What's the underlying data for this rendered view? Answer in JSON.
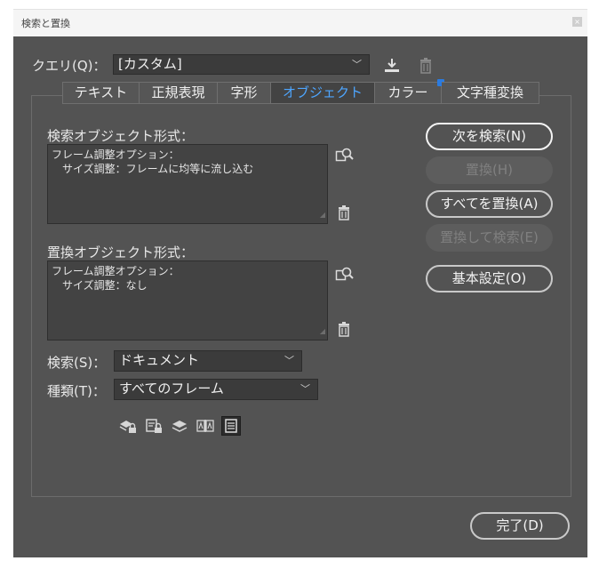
{
  "window": {
    "title": "検索と置換",
    "close_glyph": "×"
  },
  "query": {
    "label": "クエリ(Q)：",
    "value": "[カスタム]"
  },
  "tabs": [
    {
      "label": "テキスト",
      "active": false
    },
    {
      "label": "正規表現",
      "active": false
    },
    {
      "label": "字形",
      "active": false
    },
    {
      "label": "オブジェクト",
      "active": true
    },
    {
      "label": "カラー",
      "active": false,
      "badge": true
    },
    {
      "label": "文字種変換",
      "active": false
    }
  ],
  "find_format": {
    "label": "検索オブジェクト形式：",
    "lines": [
      "フレーム調整オプション：",
      "　サイズ調整：フレームに均等に流し込む"
    ]
  },
  "replace_format": {
    "label": "置換オブジェクト形式：",
    "lines": [
      "フレーム調整オプション：",
      "　サイズ調整：なし"
    ]
  },
  "search": {
    "label": "検索(S)：",
    "value": "ドキュメント"
  },
  "type": {
    "label": "種類(T)：",
    "value": "すべてのフレーム"
  },
  "buttons": {
    "find_next": "次を検索(N)",
    "replace": "置換(H)",
    "replace_all": "すべてを置換(A)",
    "replace_find": "置換して検索(E)",
    "basic_settings": "基本設定(O)",
    "done": "完了(D)"
  },
  "colors": {
    "dialog_bg": "#535353",
    "active_tab_text": "#4ea6ff",
    "badge": "#2b7be0"
  }
}
